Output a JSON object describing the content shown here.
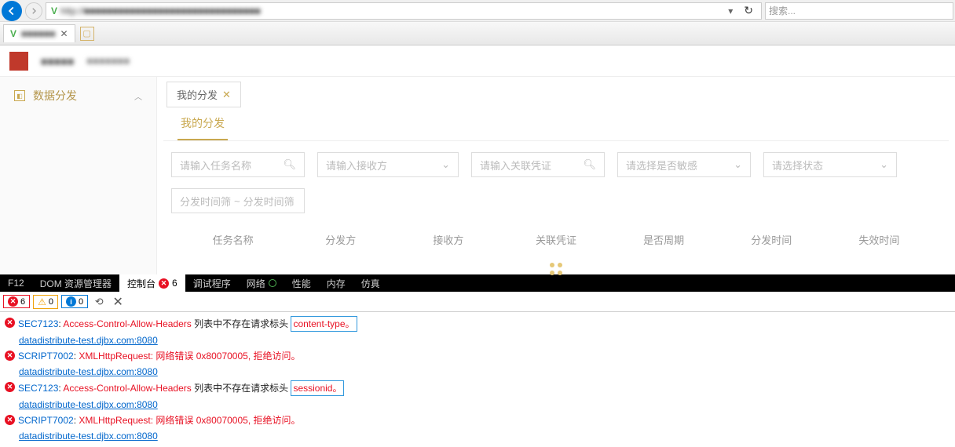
{
  "browser": {
    "url": "http://■■■■■■■■■■■■■■■■■■■■■■■■■■■■■■■",
    "search_placeholder": "搜索...",
    "tab_title": "■■■■■■"
  },
  "header": {
    "title_blur": "■■■■■",
    "subtitle_blur": "■■■■■■■"
  },
  "sidebar": {
    "items": [
      {
        "label": "数据分发"
      }
    ]
  },
  "content": {
    "tab_label": "我的分发",
    "section_tab": "我的分发",
    "filters": {
      "task_name_ph": "请输入任务名称",
      "receiver_ph": "请输入接收方",
      "voucher_ph": "请输入关联凭证",
      "sensitive_ph": "请选择是否敏感",
      "status_ph": "请选择状态",
      "range_from": "分发时间筛",
      "range_to": "分发时间筛"
    },
    "columns": [
      "任务名称",
      "分发方",
      "接收方",
      "关联凭证",
      "是否周期",
      "分发时间",
      "失效时间"
    ]
  },
  "devtools": {
    "f12": "F12",
    "tabs": {
      "dom": "DOM 资源管理器",
      "console": "控制台",
      "debugger": "调试程序",
      "network": "网络",
      "perf": "性能",
      "memory": "内存",
      "emulation": "仿真"
    },
    "console_badge": "6",
    "toolbar": {
      "err": "6",
      "warn": "0",
      "info": "0"
    },
    "messages": [
      {
        "type": "error",
        "code": "SEC7123",
        "text": "Access-Control-Allow-Headers 列表中不存在请求标头",
        "hl": "content-type。"
      },
      {
        "type": "link",
        "text": "datadistribute-test.djbx.com:8080"
      },
      {
        "type": "error",
        "code": "SCRIPT7002",
        "text": "XMLHttpRequest: 网络错误 0x80070005, 拒绝访问。"
      },
      {
        "type": "link",
        "text": "datadistribute-test.djbx.com:8080"
      },
      {
        "type": "error",
        "code": "SEC7123",
        "text": "Access-Control-Allow-Headers 列表中不存在请求标头",
        "hl": "sessionid。"
      },
      {
        "type": "link",
        "text": "datadistribute-test.djbx.com:8080"
      },
      {
        "type": "error",
        "code": "SCRIPT7002",
        "text": "XMLHttpRequest: 网络错误 0x80070005, 拒绝访问。"
      },
      {
        "type": "link",
        "text": "datadistribute-test.djbx.com:8080"
      }
    ]
  }
}
